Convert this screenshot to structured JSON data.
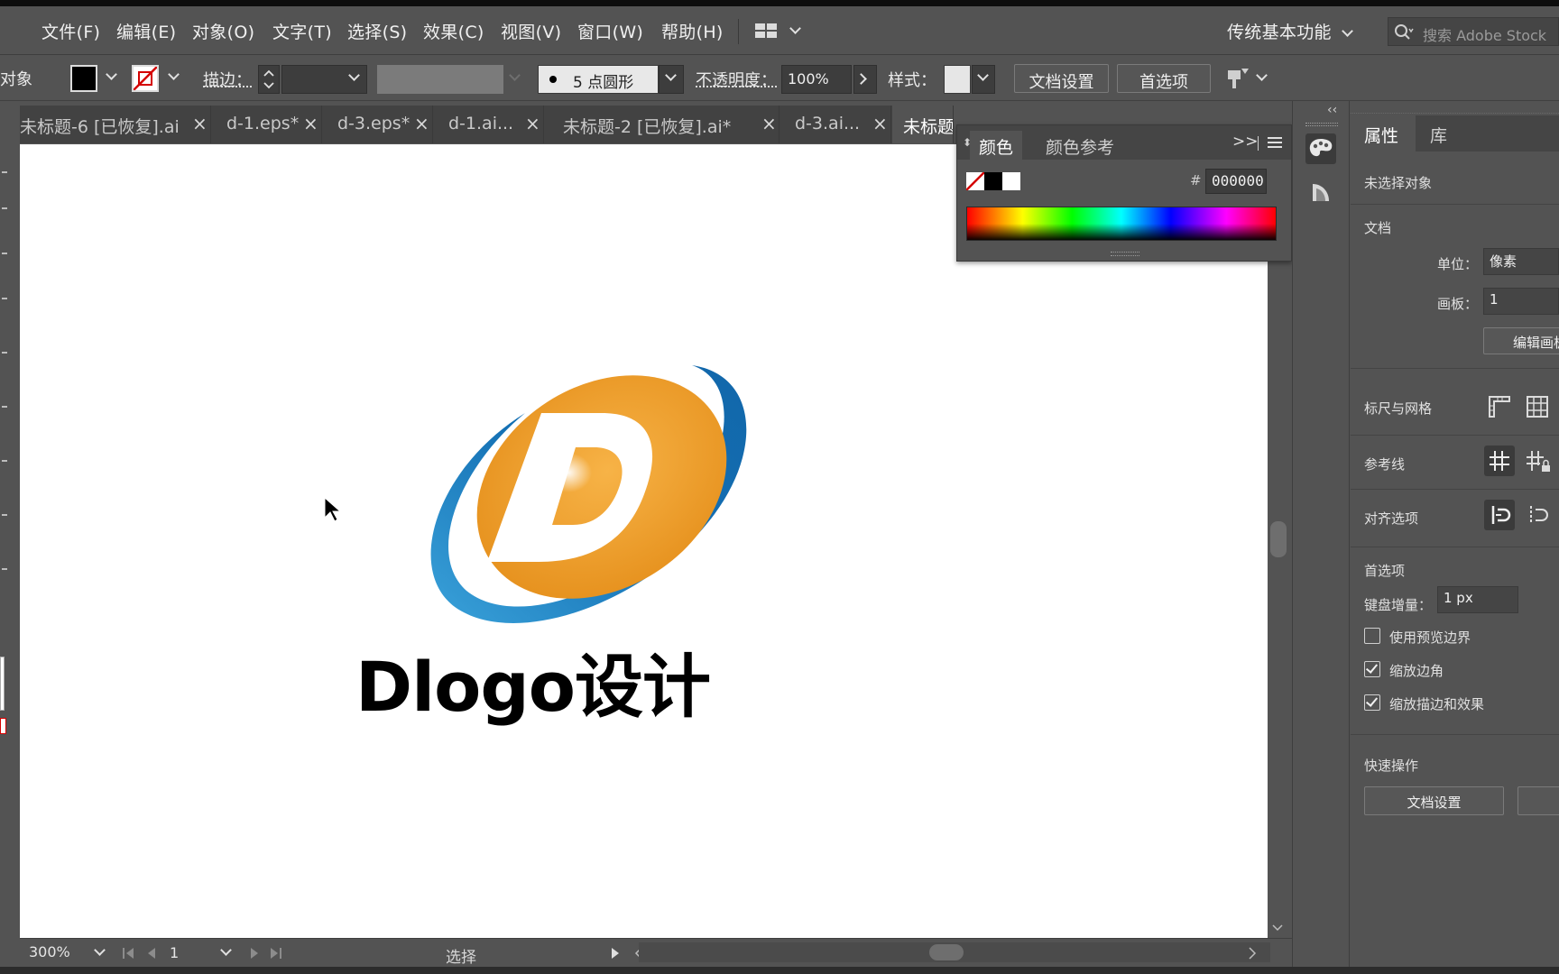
{
  "menu": {
    "items": [
      "文件(F)",
      "编辑(E)",
      "对象(O)",
      "文字(T)",
      "选择(S)",
      "效果(C)",
      "视图(V)",
      "窗口(W)",
      "帮助(H)"
    ],
    "workspace": "传统基本功能",
    "search_placeholder": "搜索 Adobe Stock"
  },
  "control": {
    "object_label": "对象",
    "stroke_label": "描边：",
    "brush": "5 点圆形",
    "opacity_label": "不透明度：",
    "opacity_value": "100%",
    "style_label": "样式：",
    "doc_setup": "文档设置",
    "preferences": "首选项"
  },
  "tabs": [
    {
      "label": "未标题-6 [已恢复].ai"
    },
    {
      "label": "d-1.eps*"
    },
    {
      "label": "d-3.eps*"
    },
    {
      "label": "d-1.ai..."
    },
    {
      "label": "未标题-2 [已恢复].ai*"
    },
    {
      "label": "d-3.ai..."
    },
    {
      "label": "未标题"
    }
  ],
  "tab_close_glyph": "×",
  "artwork": {
    "logo_letter": "D",
    "caption": "Dlogo设计",
    "orange": "#E8921F",
    "blue": "#1470B4"
  },
  "color_panel": {
    "tab_color": "颜色",
    "tab_guide": "颜色参考",
    "hash": "#",
    "hex": "000000",
    "more_glyph": ">>"
  },
  "properties": {
    "tab_props": "属性",
    "tab_library": "库",
    "no_selection": "未选择对象",
    "document": "文档",
    "unit_label": "单位：",
    "unit_value": "像素",
    "artboard_label": "画板：",
    "artboard_value": "1",
    "edit_artboards": "编辑画板",
    "rulers_grids": "标尺与网格",
    "guides": "参考线",
    "snap_options": "对齐选项",
    "preferences": "首选项",
    "keyboard_increment_label": "键盘增量：",
    "keyboard_increment_value": "1 px",
    "use_preview_bounds": "使用预览边界",
    "use_preview_bounds_checked": false,
    "scale_corners": "缩放边角",
    "scale_corners_checked": true,
    "scale_strokes_effects": "缩放描边和效果",
    "scale_strokes_effects_checked": true,
    "quick_actions": "快速操作",
    "doc_setup_button": "文档设置"
  },
  "status": {
    "zoom": "300%",
    "artboard_num": "1",
    "tool": "选择"
  },
  "collapse_glyph": "‹‹"
}
